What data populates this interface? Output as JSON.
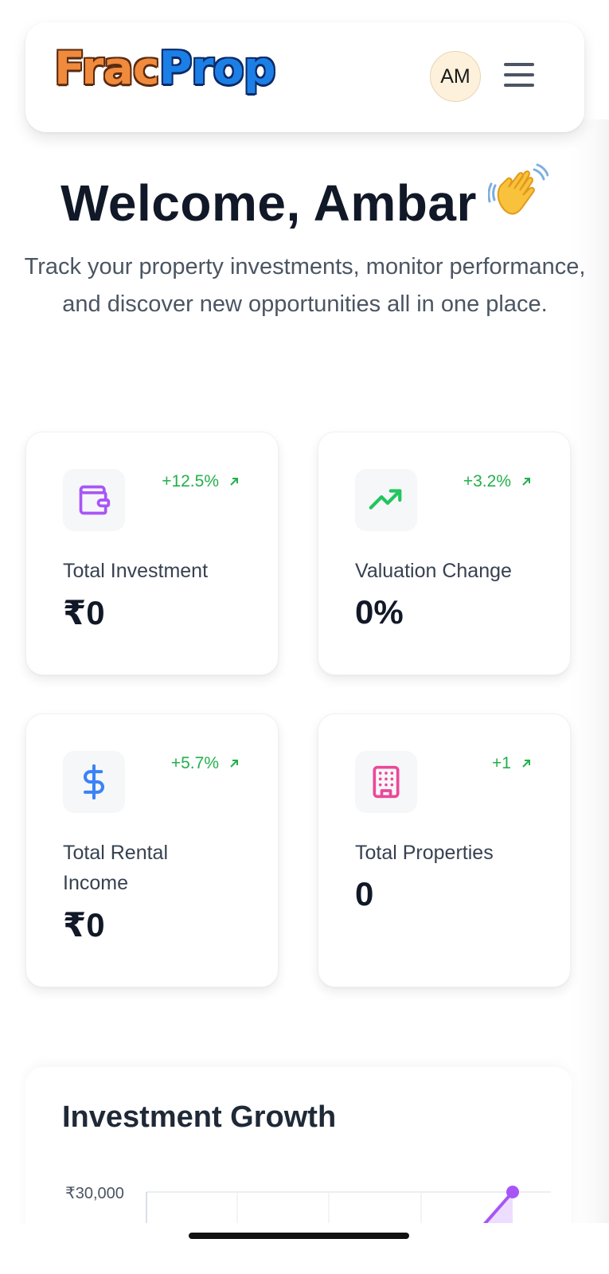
{
  "header": {
    "logo_part1": "Frac",
    "logo_part2": "Prop",
    "avatar_initials": "AM"
  },
  "hero": {
    "title": "Welcome, Ambar",
    "subtitle": "Track your property investments, monitor performance, and discover new opportunities all in one place."
  },
  "stats": [
    {
      "label": "Total Investment",
      "value": "₹0",
      "change": "+12.5%",
      "icon": "wallet-icon",
      "icon_color": "#a855f7"
    },
    {
      "label": "Valuation Change",
      "value": "0%",
      "change": "+3.2%",
      "icon": "trending-up-icon",
      "icon_color": "#22c55e"
    },
    {
      "label": "Total Rental Income",
      "value": "₹0",
      "change": "+5.7%",
      "icon": "dollar-icon",
      "icon_color": "#3b82f6"
    },
    {
      "label": "Total Properties",
      "value": "0",
      "change": "+1",
      "icon": "building-icon",
      "icon_color": "#ec4899"
    }
  ],
  "growth": {
    "title": "Investment Growth",
    "y_tick_top": "₹30,000"
  },
  "colors": {
    "positive": "#22b04b",
    "chart_accent": "#a855f7"
  }
}
